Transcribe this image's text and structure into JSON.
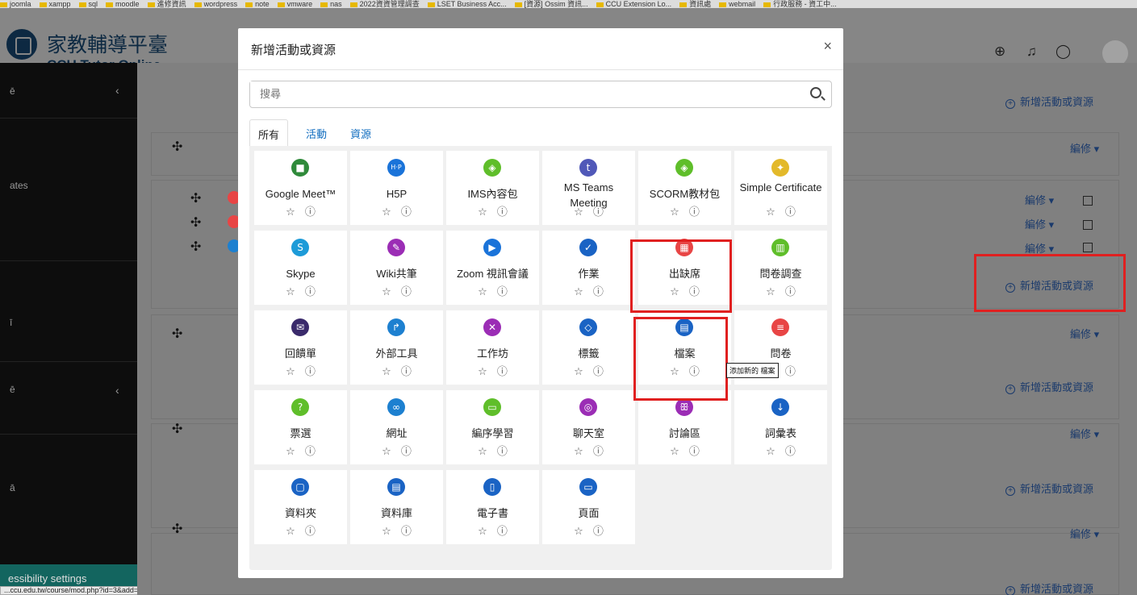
{
  "bookmarks": [
    "joomla",
    "xampp",
    "sql",
    "moodle",
    "進修資訊",
    "wordpress",
    "note",
    "vmware",
    "nas",
    "2022資資管理調查",
    "LSET Business Acc...",
    "[資源] Ossim 資訊...",
    "CCU Extension Lo...",
    "資訊處",
    "webmail",
    "行政服務 - 資工中..."
  ],
  "logo": {
    "line1": "家教輔導平臺",
    "line2": "CCU Tutor Online"
  },
  "sidebar": {
    "item1": "ates",
    "access": "essibility settings"
  },
  "status_url": "...ccu.edu.tw/course/mod.php?id=3&add=resource&section=2&sr=0",
  "page": {
    "edit_label": "編修 ▾",
    "add_label": "新增活動或資源"
  },
  "modal": {
    "title": "新增活動或資源",
    "close": "×",
    "search_placeholder": "搜尋",
    "tabs": [
      "所有",
      "活動",
      "資源"
    ],
    "star": "☆",
    "info": "ⓘ",
    "tiles": [
      {
        "label": "Google Meet™",
        "icon": "video-icon",
        "color": "#2f8a3a",
        "glyph": "■"
      },
      {
        "label": "H5P",
        "icon": "h5p-icon",
        "color": "#1a73d9",
        "glyph": "H·P"
      },
      {
        "label": "IMS內容包",
        "icon": "package-icon",
        "color": "#5fbe2a",
        "glyph": "◈"
      },
      {
        "label": "MS Teams Meeting",
        "icon": "teams-icon",
        "color": "#5058b8",
        "glyph": "t"
      },
      {
        "label": "SCORM教材包",
        "icon": "package-icon",
        "color": "#5fbe2a",
        "glyph": "◈"
      },
      {
        "label": "Simple Certificate",
        "icon": "certificate-icon",
        "color": "#e3b92a",
        "glyph": "✦"
      },
      {
        "label": "Skype",
        "icon": "skype-icon",
        "color": "#1d9bd8",
        "glyph": "S"
      },
      {
        "label": "Wiki共筆",
        "icon": "wiki-icon",
        "color": "#9b2db5",
        "glyph": "✎"
      },
      {
        "label": "Zoom 視訊會議",
        "icon": "zoom-icon",
        "color": "#1a73d9",
        "glyph": "▶"
      },
      {
        "label": "作業",
        "icon": "assignment-icon",
        "color": "#1a63c4",
        "glyph": "✓"
      },
      {
        "label": "出缺席",
        "icon": "attendance-icon",
        "color": "#e84545",
        "glyph": "▦"
      },
      {
        "label": "問卷調查",
        "icon": "survey-icon",
        "color": "#5fbe2a",
        "glyph": "▥"
      },
      {
        "label": "回饋單",
        "icon": "feedback-icon",
        "color": "#3a2a6b",
        "glyph": "✉"
      },
      {
        "label": "外部工具",
        "icon": "external-tool-icon",
        "color": "#1d80d0",
        "glyph": "↱"
      },
      {
        "label": "工作坊",
        "icon": "workshop-icon",
        "color": "#9b2db5",
        "glyph": "✕"
      },
      {
        "label": "標籤",
        "icon": "label-icon",
        "color": "#1a63c4",
        "glyph": "◇"
      },
      {
        "label": "檔案",
        "icon": "file-icon",
        "color": "#1a63c4",
        "glyph": "▤"
      },
      {
        "label": "問卷",
        "icon": "questionnaire-icon",
        "color": "#e84545",
        "glyph": "≡"
      },
      {
        "label": "票選",
        "icon": "choice-icon",
        "color": "#5fbe2a",
        "glyph": "?"
      },
      {
        "label": "網址",
        "icon": "url-icon",
        "color": "#1d80d0",
        "glyph": "∞"
      },
      {
        "label": "編序學習",
        "icon": "lesson-icon",
        "color": "#5fbe2a",
        "glyph": "▭"
      },
      {
        "label": "聊天室",
        "icon": "chat-icon",
        "color": "#9b2db5",
        "glyph": "◎"
      },
      {
        "label": "討論區",
        "icon": "forum-icon",
        "color": "#9b2db5",
        "glyph": "ꕥ"
      },
      {
        "label": "詞彙表",
        "icon": "glossary-icon",
        "color": "#1a63c4",
        "glyph": "↓"
      },
      {
        "label": "資料夾",
        "icon": "folder-icon",
        "color": "#1a63c4",
        "glyph": "▢"
      },
      {
        "label": "資料庫",
        "icon": "database-icon",
        "color": "#1a63c4",
        "glyph": "▤"
      },
      {
        "label": "電子書",
        "icon": "book-icon",
        "color": "#1a63c4",
        "glyph": "▯"
      },
      {
        "label": "頁面",
        "icon": "page-icon",
        "color": "#1a63c4",
        "glyph": "▭"
      }
    ],
    "tooltip": "添加新的 檔案"
  }
}
